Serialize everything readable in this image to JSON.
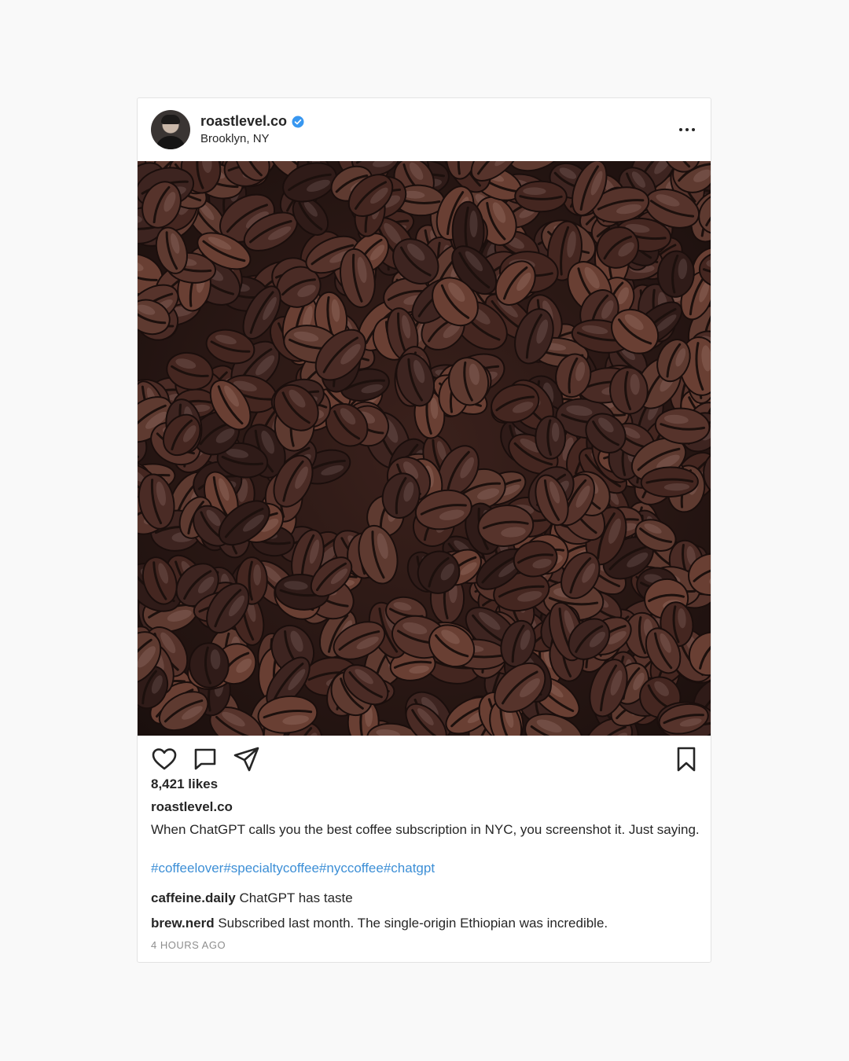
{
  "post": {
    "username": "roastlevel.co",
    "location": "Brooklyn, NY",
    "verified": true,
    "image_subject": "roasted coffee beans",
    "likes": "8,421 likes",
    "caption_user": "roastlevel.co",
    "caption_text": "When ChatGPT calls you the best coffee subscription in NYC, you screenshot it. Just saying.",
    "hashtags": [
      "#coffeelover",
      "#specialtycoffee",
      "#nyccoffee",
      "#chatgpt"
    ],
    "comments": [
      {
        "user": "caffeine.daily",
        "text": "ChatGPT has taste"
      },
      {
        "user": "brew.nerd",
        "text": "Subscribed last month. The single-origin Ethiopian was incredible."
      }
    ],
    "timestamp": "4 HOURS AGO"
  },
  "icons": {
    "verified": "verified-badge-icon",
    "more": "more-options-icon",
    "like": "heart-icon",
    "comment": "comment-icon",
    "share": "send-icon",
    "save": "bookmark-icon"
  },
  "colors": {
    "background": "#f9f9f9",
    "card": "#ffffff",
    "text": "#262626",
    "hashtag": "#3d8fd6",
    "verified": "#3897f0",
    "muted": "#8e8e8e"
  }
}
